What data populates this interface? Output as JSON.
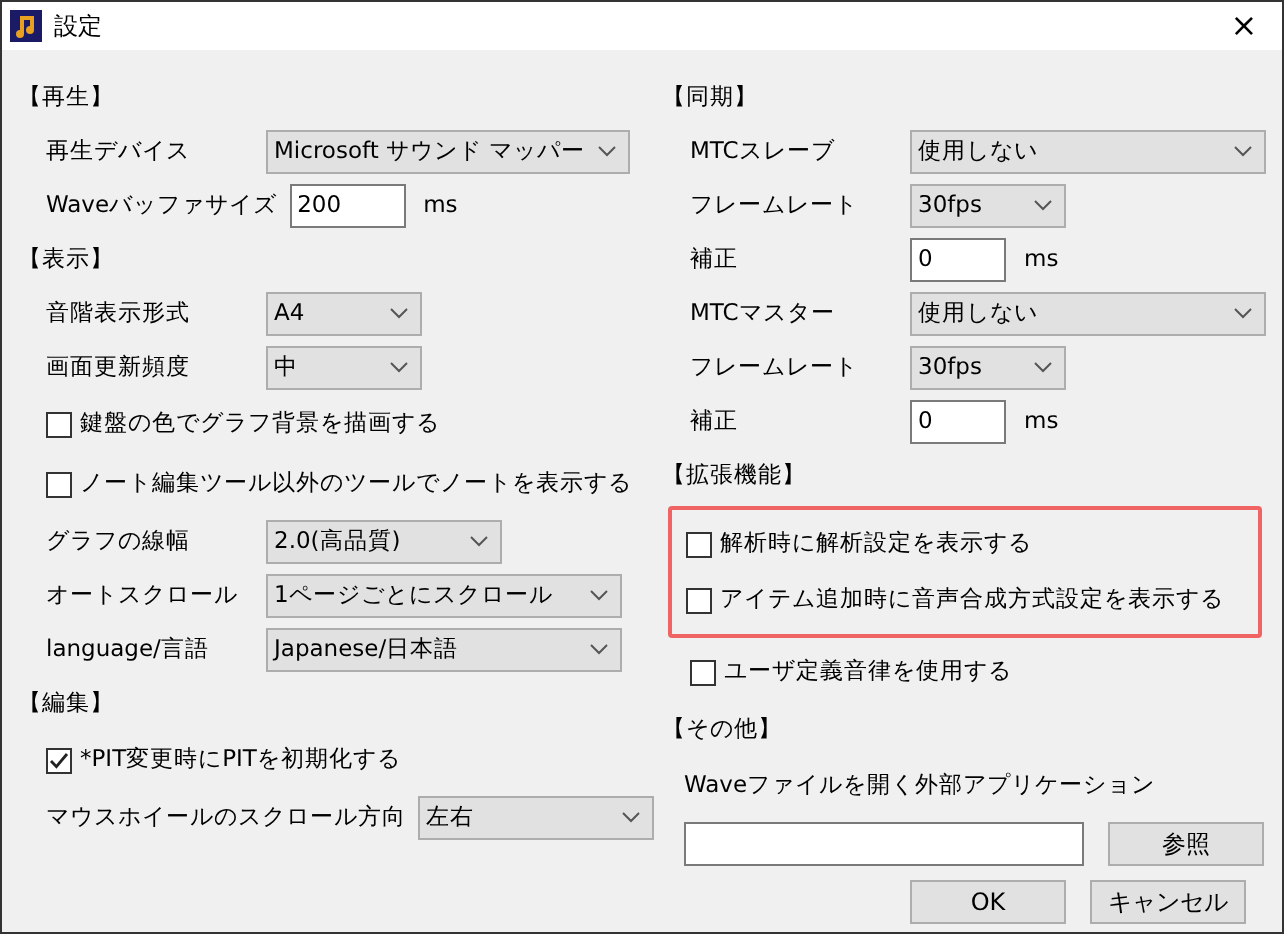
{
  "window": {
    "title": "設定",
    "close": "×"
  },
  "columns": [
    {
      "sections": [
        {
          "heading": "【再生】",
          "items": [
            {
              "kind": "select",
              "label": "再生デバイス",
              "value": "Microsoft サウンド マッパー"
            },
            {
              "kind": "input",
              "label": "Waveバッファサイズ",
              "value": "200",
              "unit": "ms"
            }
          ]
        },
        {
          "heading": "【表示】",
          "items": [
            {
              "kind": "select",
              "label": "音階表示形式",
              "value": "A4"
            },
            {
              "kind": "select",
              "label": "画面更新頻度",
              "value": "中"
            },
            {
              "kind": "checkbox",
              "label": "鍵盤の色でグラフ背景を描画する",
              "checked": false
            },
            {
              "kind": "checkbox",
              "label": "ノート編集ツール以外のツールでノートを表示する",
              "checked": false
            },
            {
              "kind": "select",
              "label": "グラフの線幅",
              "value": "2.0(高品質)"
            },
            {
              "kind": "select",
              "label": "オートスクロール",
              "value": "1ページごとにスクロール"
            },
            {
              "kind": "select",
              "label": "language/言語",
              "value": "Japanese/日本語"
            }
          ]
        },
        {
          "heading": "【編集】",
          "items": [
            {
              "kind": "checkbox",
              "label": "*PIT変更時にPITを初期化する",
              "checked": true
            },
            {
              "kind": "select",
              "label": "マウスホイールのスクロール方向",
              "value": "左右"
            }
          ]
        }
      ]
    },
    {
      "sections": [
        {
          "heading": "【同期】",
          "items": [
            {
              "kind": "select",
              "label": "MTCスレーブ",
              "value": "使用しない"
            },
            {
              "kind": "select",
              "label": "フレームレート",
              "value": "30fps"
            },
            {
              "kind": "input",
              "label": "補正",
              "value": "0",
              "unit": "ms"
            },
            {
              "kind": "select",
              "label": "MTCマスター",
              "value": "使用しない"
            },
            {
              "kind": "select",
              "label": "フレームレート",
              "value": "30fps"
            },
            {
              "kind": "input",
              "label": "補正",
              "value": "0",
              "unit": "ms"
            }
          ]
        },
        {
          "heading": "【拡張機能】",
          "items": [
            {
              "kind": "checkbox",
              "label": "解析時に解析設定を表示する",
              "checked": false,
              "highlighted": true
            },
            {
              "kind": "checkbox",
              "label": "アイテム追加時に音声合成方式設定を表示する",
              "checked": false,
              "highlighted": true
            },
            {
              "kind": "checkbox",
              "label": "ユーザ定義音律を使用する",
              "checked": false,
              "highlighted": false
            }
          ]
        },
        {
          "heading": "【その他】",
          "items": [
            {
              "kind": "caption",
              "label": "Waveファイルを開く外部アプリケーション"
            },
            {
              "kind": "path",
              "value": "",
              "button": "参照"
            }
          ]
        }
      ]
    }
  ],
  "buttons": [
    "OK",
    "キャンセル"
  ]
}
